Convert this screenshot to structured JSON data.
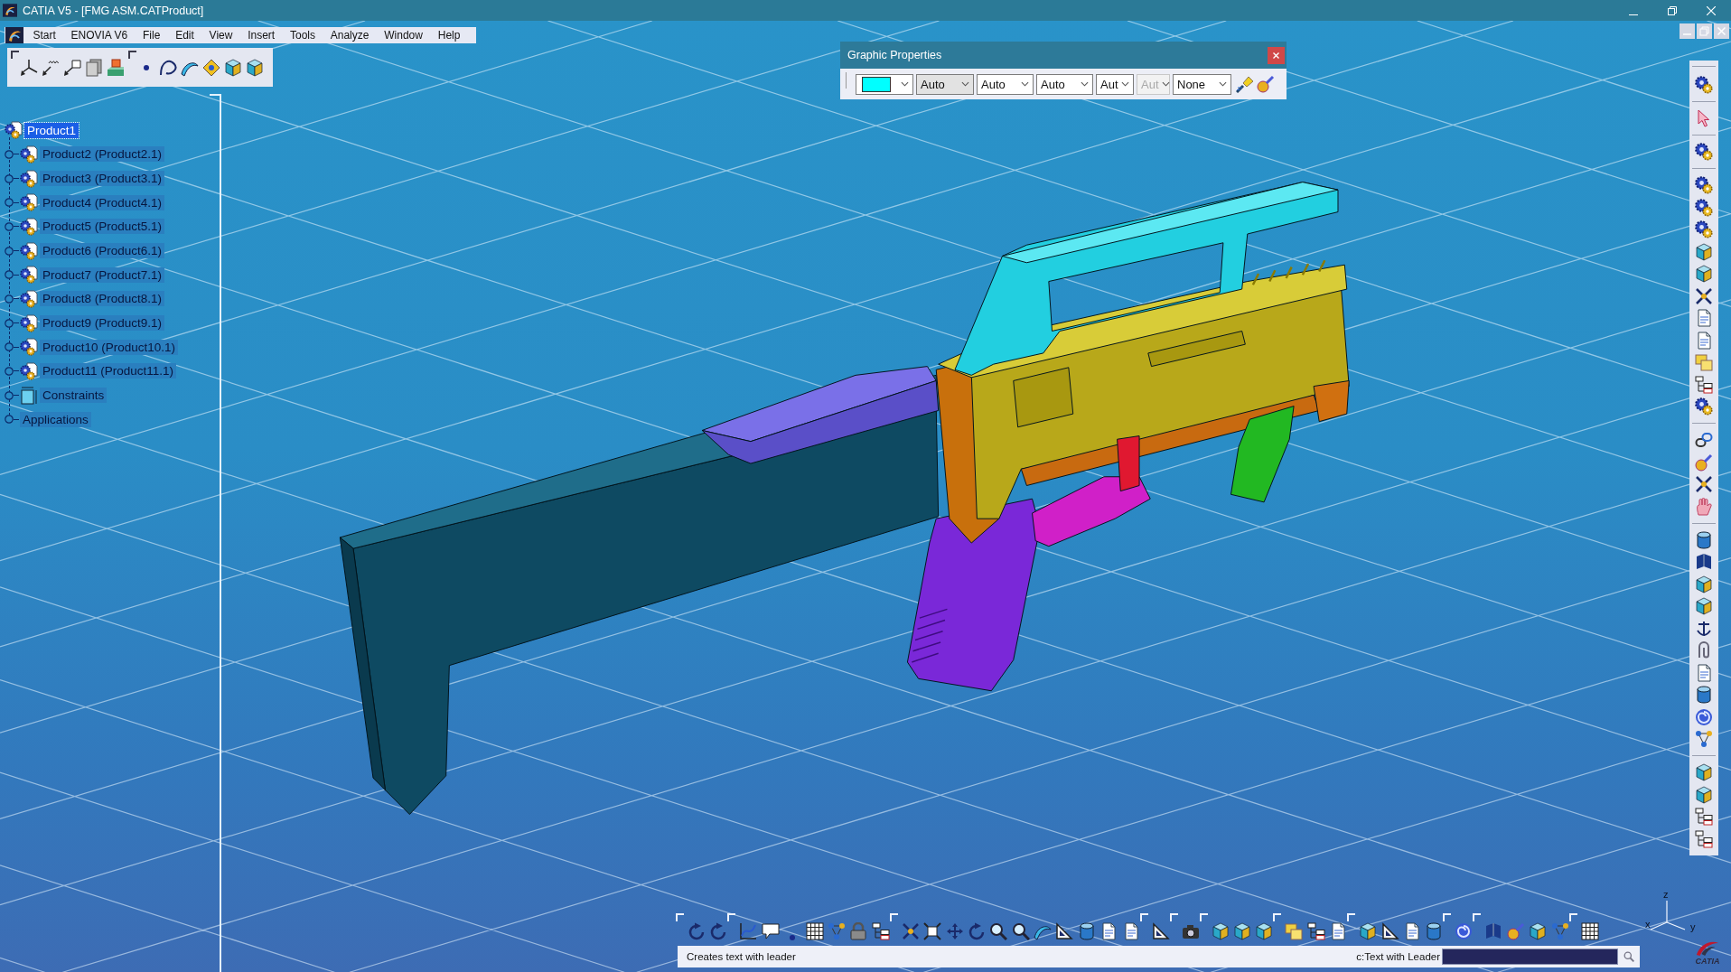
{
  "window": {
    "title": "CATIA V5 - [FMG ASM.CATProduct]"
  },
  "menu_bar": {
    "items": [
      "Start",
      "ENOVIA V6",
      "File",
      "Edit",
      "View",
      "Insert",
      "Tools",
      "Analyze",
      "Window",
      "Help"
    ]
  },
  "spec_tree": {
    "root": {
      "label": "Product1",
      "kind": "product",
      "selected": true,
      "children": [
        {
          "label": "Product2 (Product2.1)",
          "kind": "product",
          "selected": false,
          "expanded": false
        },
        {
          "label": "Product3 (Product3.1)",
          "kind": "product",
          "selected": false,
          "expanded": false
        },
        {
          "label": "Product4 (Product4.1)",
          "kind": "product",
          "selected": false,
          "expanded": false
        },
        {
          "label": "Product5 (Product5.1)",
          "kind": "product",
          "selected": false,
          "expanded": false
        },
        {
          "label": "Product6 (Product6.1)",
          "kind": "product",
          "selected": false,
          "expanded": false
        },
        {
          "label": "Product7 (Product7.1)",
          "kind": "product",
          "selected": false,
          "expanded": false
        },
        {
          "label": "Product8 (Product8.1)",
          "kind": "product",
          "selected": false,
          "expanded": false
        },
        {
          "label": "Product9 (Product9.1)",
          "kind": "product",
          "selected": false,
          "expanded": false
        },
        {
          "label": "Product10 (Product10.1)",
          "kind": "product",
          "selected": false,
          "expanded": false
        },
        {
          "label": "Product11 (Product11.1)",
          "kind": "product",
          "selected": false,
          "expanded": false
        },
        {
          "label": "Constraints",
          "kind": "constraints",
          "selected": false,
          "expanded": false
        },
        {
          "label": "Applications",
          "kind": "applications",
          "selected": false,
          "expanded": false
        }
      ]
    }
  },
  "graphic_properties": {
    "title": "Graphic Properties",
    "color_field": {
      "color": "#00ffff"
    },
    "dropdowns": [
      {
        "value": "Auto",
        "highlighted": true,
        "disabled": false
      },
      {
        "value": "Auto",
        "highlighted": false,
        "disabled": false
      },
      {
        "value": "Auto",
        "highlighted": false,
        "disabled": false
      },
      {
        "value": "Aut",
        "highlighted": false,
        "disabled": false
      },
      {
        "value": "Aut",
        "highlighted": false,
        "disabled": true
      },
      {
        "value": "None",
        "highlighted": false,
        "disabled": false
      }
    ]
  },
  "axis_triad": {
    "labels": [
      "z",
      "x",
      "y"
    ]
  },
  "status_bar": {
    "message": "Creates text with leader",
    "command_label": "c:Text with Leader"
  },
  "logo": {
    "text": "CATIA"
  }
}
